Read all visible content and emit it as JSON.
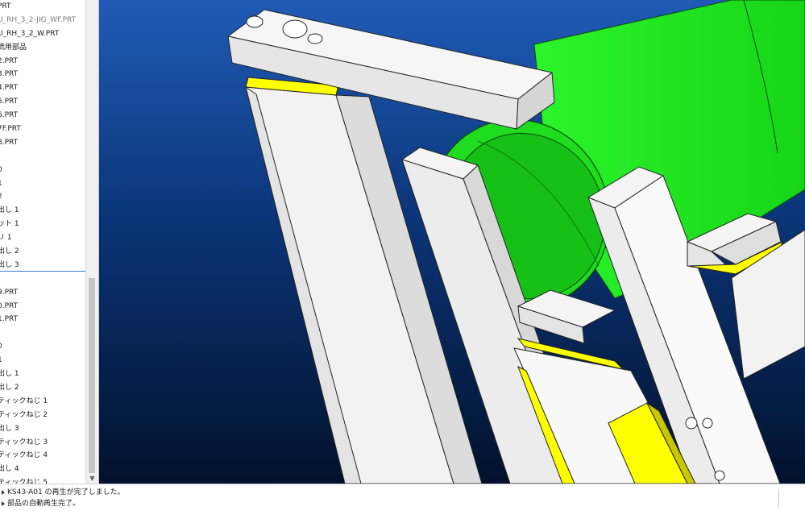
{
  "model_tree": {
    "items": [
      {
        "label": "PRT",
        "dim": false
      },
      {
        "label": "U_RH_3_2-JIG_WF.PRT",
        "dim": true
      },
      {
        "label": "U_RH_3_2_W.PRT",
        "dim": false
      },
      {
        "label": "流用部品",
        "dim": false
      },
      {
        "label": "2.PRT",
        "dim": false
      },
      {
        "label": "3.PRT",
        "dim": false
      },
      {
        "label": "4.PRT",
        "dim": false
      },
      {
        "label": "5.PRT",
        "dim": false
      },
      {
        "label": "6.PRT",
        "dim": false
      },
      {
        "label": "7F.PRT",
        "dim": false
      },
      {
        "label": "8.PRT",
        "dim": false
      },
      {
        "label": "",
        "dim": false
      },
      {
        "label": "0",
        "dim": false
      },
      {
        "label": "1",
        "dim": false
      },
      {
        "label": "2",
        "dim": false
      },
      {
        "label": "出し 1",
        "dim": false
      },
      {
        "label": "ット 1",
        "dim": false
      },
      {
        "label": "リ 1",
        "dim": false
      },
      {
        "label": "出し 2",
        "dim": false
      },
      {
        "label": "出し 3",
        "dim": false
      },
      {
        "label": "",
        "dim": false
      },
      {
        "label": "9.PRT",
        "dim": false
      },
      {
        "label": "0.PRT",
        "dim": false
      },
      {
        "label": "1.PRT",
        "dim": false
      },
      {
        "label": "",
        "dim": false
      },
      {
        "label": "0",
        "dim": false
      },
      {
        "label": "1",
        "dim": false
      },
      {
        "label": "出し 1",
        "dim": false
      },
      {
        "label": "出し 2",
        "dim": false
      },
      {
        "label": "ティックねじ 1",
        "dim": false
      },
      {
        "label": "ティックねじ 2",
        "dim": false
      },
      {
        "label": "出し 3",
        "dim": false
      },
      {
        "label": "ティックねじ 3",
        "dim": false
      },
      {
        "label": "ティックねじ 4",
        "dim": false
      },
      {
        "label": "出し 4",
        "dim": false
      },
      {
        "label": "ティックねじ 5",
        "dim": false
      }
    ]
  },
  "status": {
    "line1": "KS43-A01 の再生が完了しました。",
    "line2": "部品の自動再生完了。"
  },
  "icons": {
    "scroll_down": "chevron-down-icon",
    "status_bullet": "triangle-right-icon"
  },
  "colors": {
    "viewport_top": "#1f5bb6",
    "viewport_bottom": "#02112c",
    "part_white": "#ffffff",
    "part_yellow": "#ffff00",
    "tube_green": "#22ee22",
    "tree_separator": "#3a7fd5"
  }
}
